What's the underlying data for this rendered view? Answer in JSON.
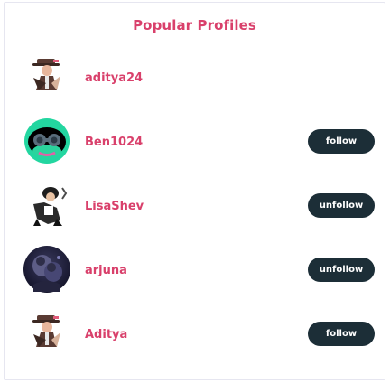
{
  "panel": {
    "title": "Popular Profiles"
  },
  "profiles": [
    {
      "username": "aditya24",
      "avatar_icon": "person-fedora-avatar-icon",
      "button_label": ""
    },
    {
      "username": "Ben1024",
      "avatar_icon": "goggles-character-avatar-icon",
      "button_label": "follow"
    },
    {
      "username": "LisaShev",
      "avatar_icon": "seated-figure-avatar-icon",
      "button_label": "unfollow"
    },
    {
      "username": "arjuna",
      "avatar_icon": "dark-portrait-avatar-icon",
      "button_label": "unfollow"
    },
    {
      "username": "Aditya",
      "avatar_icon": "person-fedora-avatar-icon",
      "button_label": "follow"
    }
  ],
  "colors": {
    "accent": "#d9406b",
    "button_bg": "#1c2e37",
    "button_text": "#ffffff"
  }
}
